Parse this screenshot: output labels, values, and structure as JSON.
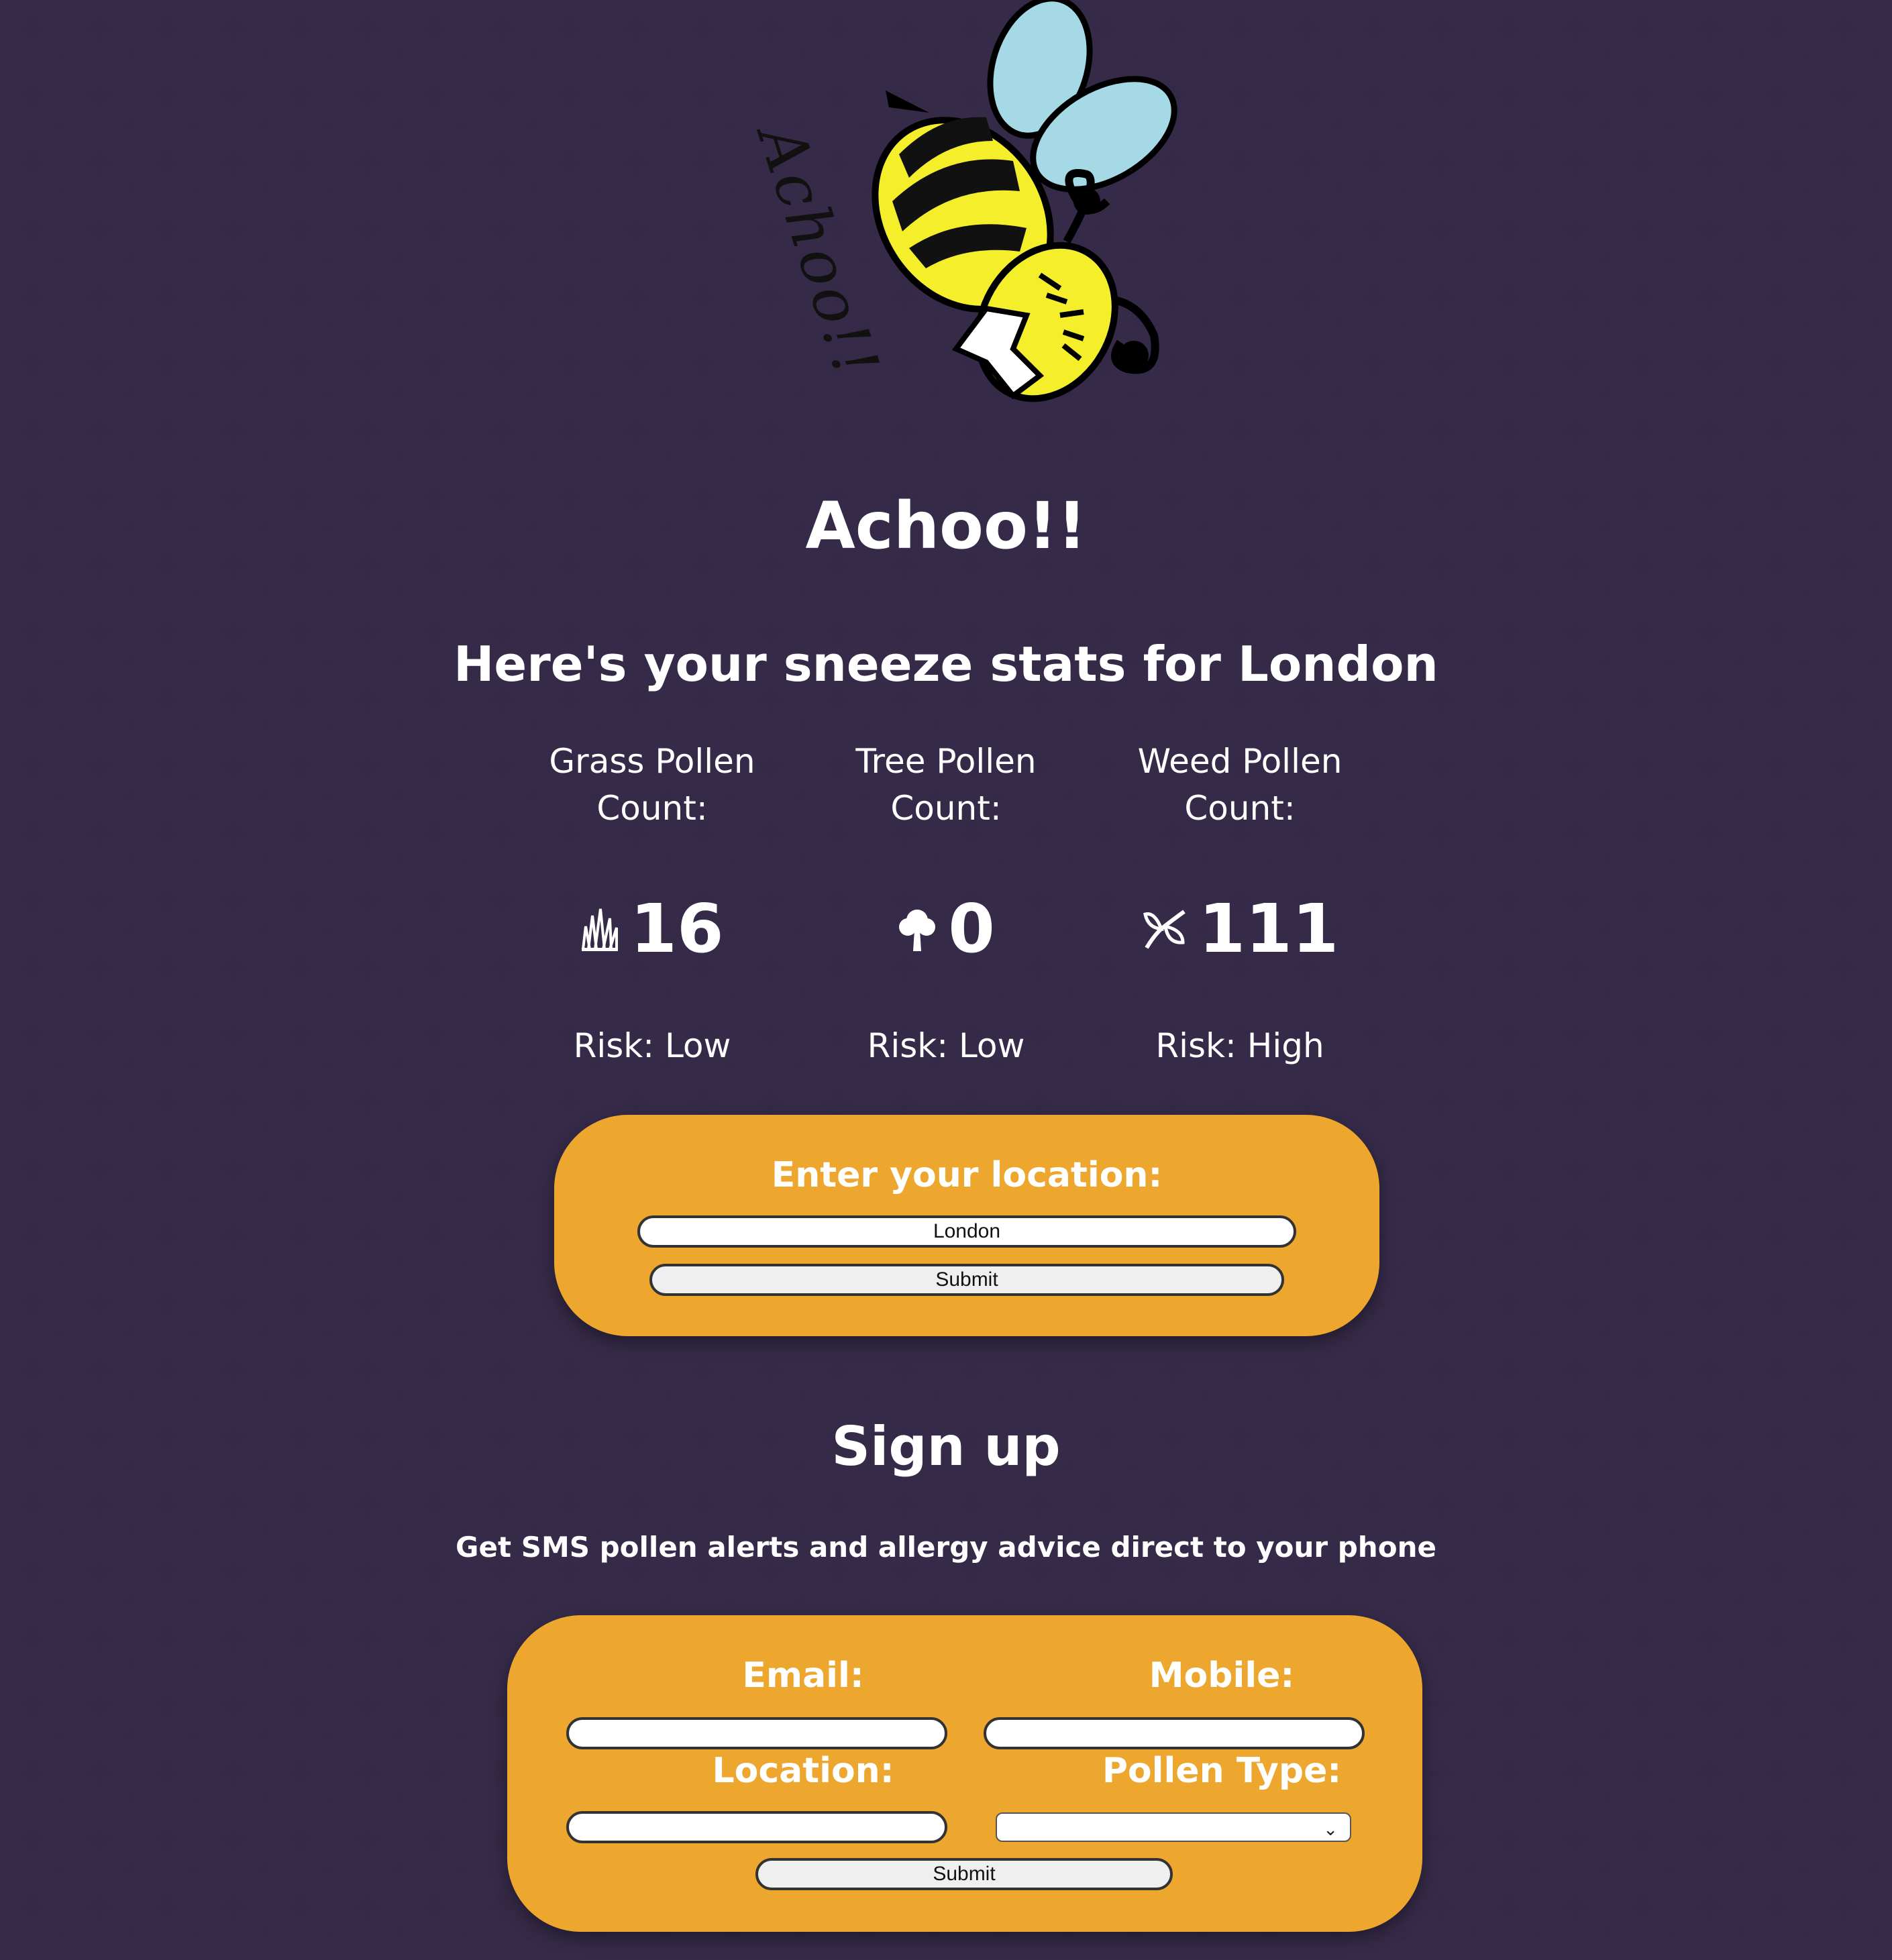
{
  "logo": {
    "icon": "sneezing-bee-icon",
    "text": "Achoo!!"
  },
  "title": "Achoo!!",
  "subtitle": "Here's your sneeze stats for London",
  "stats": [
    {
      "label": "Grass Pollen Count:",
      "icon": "grass-icon",
      "value": "16",
      "risk": "Risk: Low"
    },
    {
      "label": "Tree Pollen Count:",
      "icon": "tree-icon",
      "value": "0",
      "risk": "Risk: Low"
    },
    {
      "label": "Weed Pollen Count:",
      "icon": "weed-icon",
      "value": "111",
      "risk": "Risk: High"
    }
  ],
  "location_form": {
    "label": "Enter your location:",
    "value": "London",
    "submit": "Submit"
  },
  "signup": {
    "title": "Sign up",
    "subtitle": "Get SMS pollen alerts and allergy advice direct to your phone",
    "email_label": "Email:",
    "mobile_label": "Mobile:",
    "location_label": "Location:",
    "pollen_label": "Pollen Type:",
    "pollen_selected": "",
    "submit": "Submit"
  },
  "colors": {
    "background": "#413357",
    "pattern": "#342946",
    "panel": "#eda72f",
    "bee_yellow": "#f5ee2a",
    "wing_blue": "#a6d9e6"
  }
}
